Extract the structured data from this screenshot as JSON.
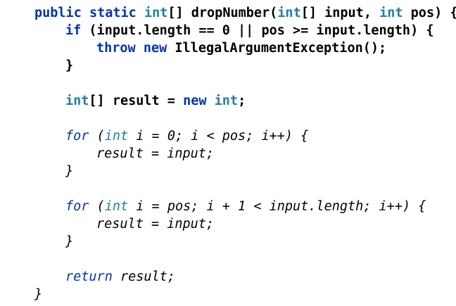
{
  "editor": {
    "lines": [
      {
        "indent": 1,
        "tokens": [
          {
            "t": "public",
            "c": "kw-blue"
          },
          {
            "t": " ",
            "c": "plain"
          },
          {
            "t": "static",
            "c": "kw-blue"
          },
          {
            "t": " ",
            "c": "plain"
          },
          {
            "t": "int",
            "c": "kw-type"
          },
          {
            "t": "[] dropNumber(",
            "c": "plain"
          },
          {
            "t": "int",
            "c": "kw-type"
          },
          {
            "t": "[] input, ",
            "c": "plain"
          },
          {
            "t": "int",
            "c": "kw-type"
          },
          {
            "t": " pos) {",
            "c": "plain"
          }
        ]
      },
      {
        "indent": 2,
        "tokens": [
          {
            "t": "if",
            "c": "kw-blue"
          },
          {
            "t": " (input.length == 0 || pos >= input.length) {",
            "c": "plain"
          }
        ]
      },
      {
        "indent": 3,
        "tokens": [
          {
            "t": "throw",
            "c": "kw-blue"
          },
          {
            "t": " ",
            "c": "plain"
          },
          {
            "t": "new",
            "c": "kw-blue"
          },
          {
            "t": " IllegalArgumentException();",
            "c": "plain"
          }
        ]
      },
      {
        "indent": 2,
        "tokens": [
          {
            "t": "}",
            "c": "plain"
          }
        ]
      },
      {
        "indent": 0,
        "tokens": []
      },
      {
        "indent": 2,
        "tokens": [
          {
            "t": "int",
            "c": "kw-type"
          },
          {
            "t": "[] result = ",
            "c": "plain"
          },
          {
            "t": "new",
            "c": "kw-blue"
          },
          {
            "t": " ",
            "c": "plain"
          },
          {
            "t": "int",
            "c": "kw-type"
          },
          {
            "t": ";",
            "c": "plain"
          }
        ]
      },
      {
        "indent": 0,
        "tokens": []
      },
      {
        "indent": 2,
        "tokens": [
          {
            "t": "for",
            "c": "kw-italic"
          },
          {
            "t": " (",
            "c": "italic"
          },
          {
            "t": "int",
            "c": "type-italic"
          },
          {
            "t": " i = 0; i < pos; i++) {",
            "c": "italic"
          }
        ]
      },
      {
        "indent": 3,
        "tokens": [
          {
            "t": "result = input;",
            "c": "italic"
          }
        ]
      },
      {
        "indent": 2,
        "tokens": [
          {
            "t": "}",
            "c": "italic"
          }
        ]
      },
      {
        "indent": 0,
        "tokens": []
      },
      {
        "indent": 2,
        "tokens": [
          {
            "t": "for",
            "c": "kw-italic"
          },
          {
            "t": " (",
            "c": "italic"
          },
          {
            "t": "int",
            "c": "type-italic"
          },
          {
            "t": " i = pos; i + 1 < input.length; i++) {",
            "c": "italic"
          }
        ]
      },
      {
        "indent": 3,
        "tokens": [
          {
            "t": "result = input;",
            "c": "italic"
          }
        ]
      },
      {
        "indent": 2,
        "tokens": [
          {
            "t": "}",
            "c": "italic"
          }
        ]
      },
      {
        "indent": 0,
        "tokens": []
      },
      {
        "indent": 2,
        "tokens": [
          {
            "t": "return",
            "c": "kw-italic"
          },
          {
            "t": " result;",
            "c": "italic"
          }
        ]
      },
      {
        "indent": 1,
        "tokens": [
          {
            "t": "}",
            "c": "italic"
          }
        ]
      }
    ]
  }
}
